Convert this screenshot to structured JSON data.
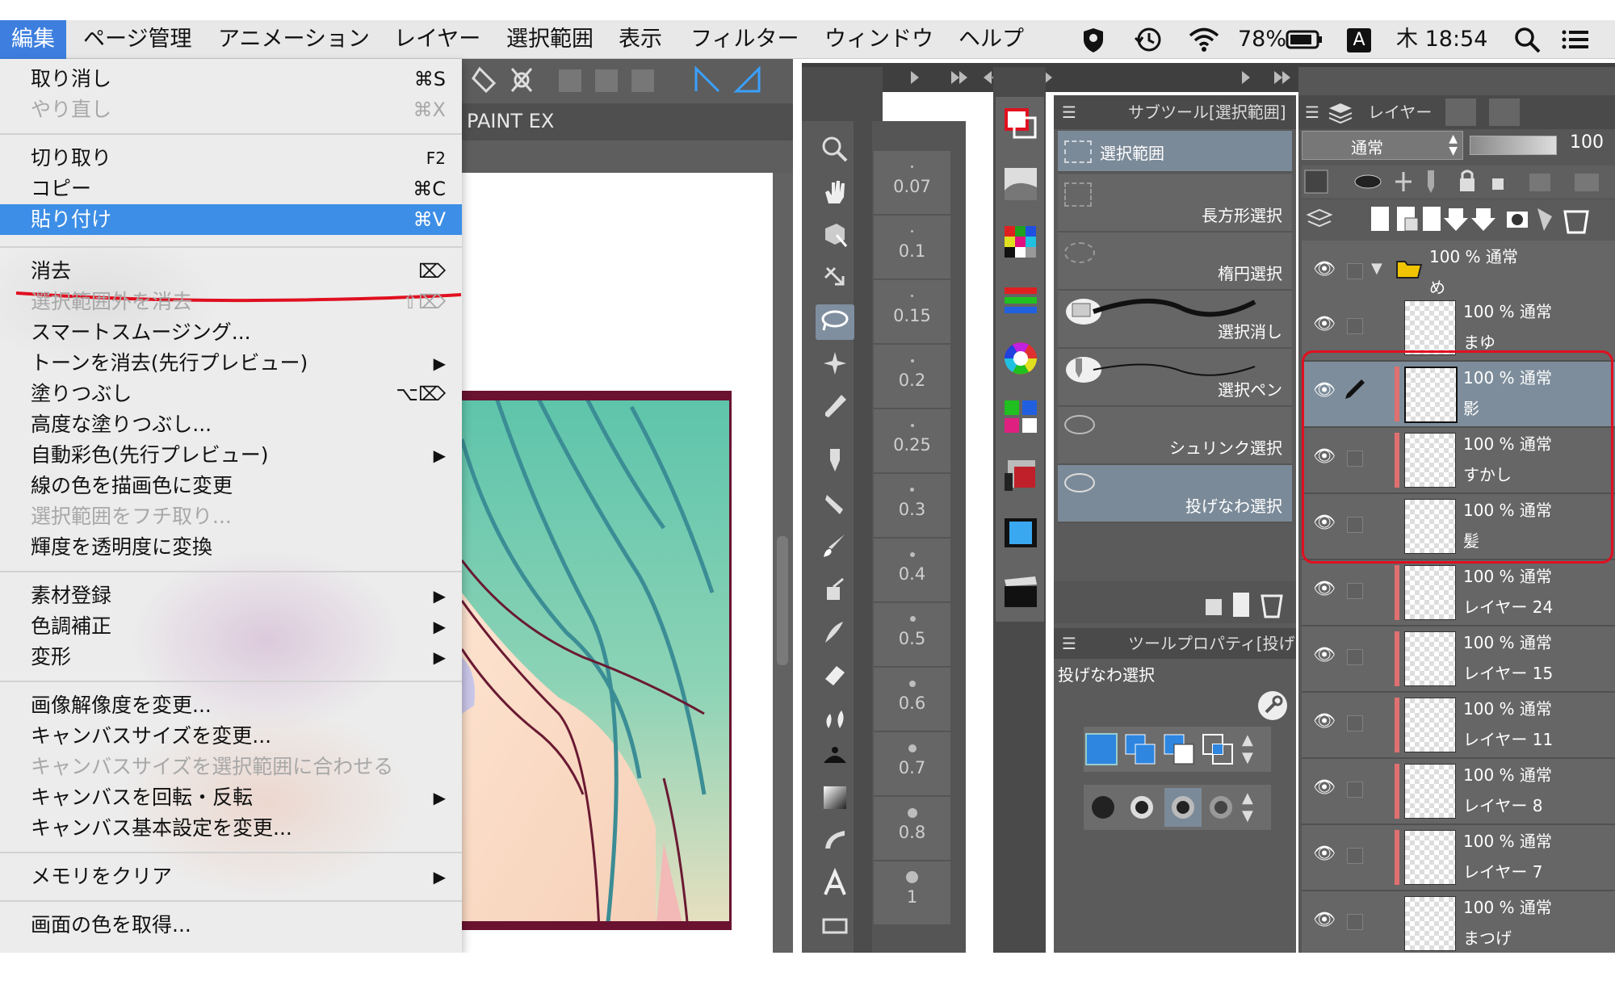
{
  "menubar": {
    "items": [
      "編集",
      "ページ管理",
      "アニメーション",
      "レイヤー",
      "選択範囲",
      "表示",
      "フィルター",
      "ウィンドウ",
      "ヘルプ"
    ],
    "active_index": 0,
    "battery": "78%",
    "input_source": "A",
    "clock": "木 18:54"
  },
  "edit_menu": {
    "items": [
      {
        "label": "取り消し",
        "shortcut": "⌘S",
        "disabled": false
      },
      {
        "label": "やり直し",
        "shortcut": "⌘X",
        "disabled": true
      },
      {
        "label": "切り取り",
        "shortcut": "F2",
        "disabled": false
      },
      {
        "label": "コピー",
        "shortcut": "⌘C",
        "disabled": false
      },
      {
        "label": "貼り付け",
        "shortcut": "⌘V",
        "disabled": false,
        "highlighted": true
      },
      {
        "label": "消去",
        "shortcut": "⌦",
        "disabled": false
      },
      {
        "label": "選択範囲外を消去",
        "shortcut": "⇧⌦",
        "disabled": true
      },
      {
        "label": "スマートスムージング...",
        "shortcut": "",
        "disabled": false
      },
      {
        "label": "トーンを消去(先行プレビュー)",
        "shortcut": "▶",
        "disabled": false
      },
      {
        "label": "塗りつぶし",
        "shortcut": "⌥⌦",
        "disabled": false
      },
      {
        "label": "高度な塗りつぶし...",
        "shortcut": "",
        "disabled": false
      },
      {
        "label": "自動彩色(先行プレビュー)",
        "shortcut": "▶",
        "disabled": false
      },
      {
        "label": "線の色を描画色に変更",
        "shortcut": "",
        "disabled": false
      },
      {
        "label": "選択範囲をフチ取り...",
        "shortcut": "",
        "disabled": true
      },
      {
        "label": "輝度を透明度に変換",
        "shortcut": "",
        "disabled": false
      },
      {
        "label": "素材登録",
        "shortcut": "▶",
        "disabled": false
      },
      {
        "label": "色調補正",
        "shortcut": "▶",
        "disabled": false
      },
      {
        "label": "変形",
        "shortcut": "▶",
        "disabled": false
      },
      {
        "label": "画像解像度を変更...",
        "shortcut": "",
        "disabled": false
      },
      {
        "label": "キャンバスサイズを変更...",
        "shortcut": "",
        "disabled": false
      },
      {
        "label": "キャンバスサイズを選択範囲に合わせる",
        "shortcut": "",
        "disabled": true
      },
      {
        "label": "キャンバスを回転・反転",
        "shortcut": "▶",
        "disabled": false
      },
      {
        "label": "キャンバス基本設定を変更...",
        "shortcut": "",
        "disabled": false
      },
      {
        "label": "メモリをクリア",
        "shortcut": "▶",
        "disabled": false
      },
      {
        "label": "画面の色を取得...",
        "shortcut": "",
        "disabled": false
      }
    ]
  },
  "document": {
    "tab_title": "PAINT EX"
  },
  "brush_sizes": [
    "0.07",
    "0.1",
    "0.15",
    "0.2",
    "0.25",
    "0.3",
    "0.4",
    "0.5",
    "0.6",
    "0.7",
    "0.8",
    "1"
  ],
  "subtool_panel": {
    "title": "サブツール[選択範囲]",
    "group": "選択範囲",
    "items": [
      "長方形選択",
      "楕円選択",
      "選択消し",
      "選択ペン",
      "シュリンク選択",
      "投げなわ選択"
    ],
    "selected_index": 5
  },
  "tool_property": {
    "title": "ツールプロパティ[投げ",
    "tool_name": "投げなわ選択"
  },
  "layer_panel": {
    "title": "レイヤー",
    "blend_mode": "通常",
    "opacity": "100",
    "folder": {
      "mode": "100 % 通常",
      "name": "め"
    },
    "layers": [
      {
        "mode": "100 % 通常",
        "name": "まゆ"
      },
      {
        "mode": "100 % 通常",
        "name": "影",
        "selected": true
      },
      {
        "mode": "100 % 通常",
        "name": "すかし"
      },
      {
        "mode": "100 % 通常",
        "name": "髪"
      },
      {
        "mode": "100 % 通常",
        "name": "レイヤー 24"
      },
      {
        "mode": "100 % 通常",
        "name": "レイヤー 15"
      },
      {
        "mode": "100 % 通常",
        "name": "レイヤー 11"
      },
      {
        "mode": "100 % 通常",
        "name": "レイヤー 8"
      },
      {
        "mode": "100 % 通常",
        "name": "レイヤー 7"
      },
      {
        "mode": "100 % 通常",
        "name": "まつげ"
      }
    ]
  },
  "colors": {
    "menu_highlight": "#3d8ee6",
    "annotation_red": "#e01020",
    "layer_selected": "#7d8d9b"
  }
}
